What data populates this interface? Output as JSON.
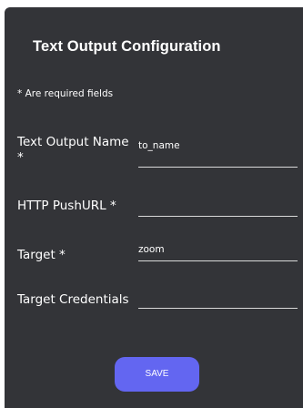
{
  "title": "Text Output Configuration",
  "required_note": "* Are required fields",
  "fields": [
    {
      "label": "Text Output Name *",
      "value": "to_name"
    },
    {
      "label": "HTTP PushURL *",
      "value": ""
    },
    {
      "label": "Target *",
      "value": "zoom"
    },
    {
      "label": "Target Credentials",
      "value": ""
    }
  ],
  "save_label": "SAVE",
  "colors": {
    "panel_background": "#333438",
    "accent_button": "#6366f1",
    "text": "#ffffff",
    "underline": "#d9d9d9"
  }
}
